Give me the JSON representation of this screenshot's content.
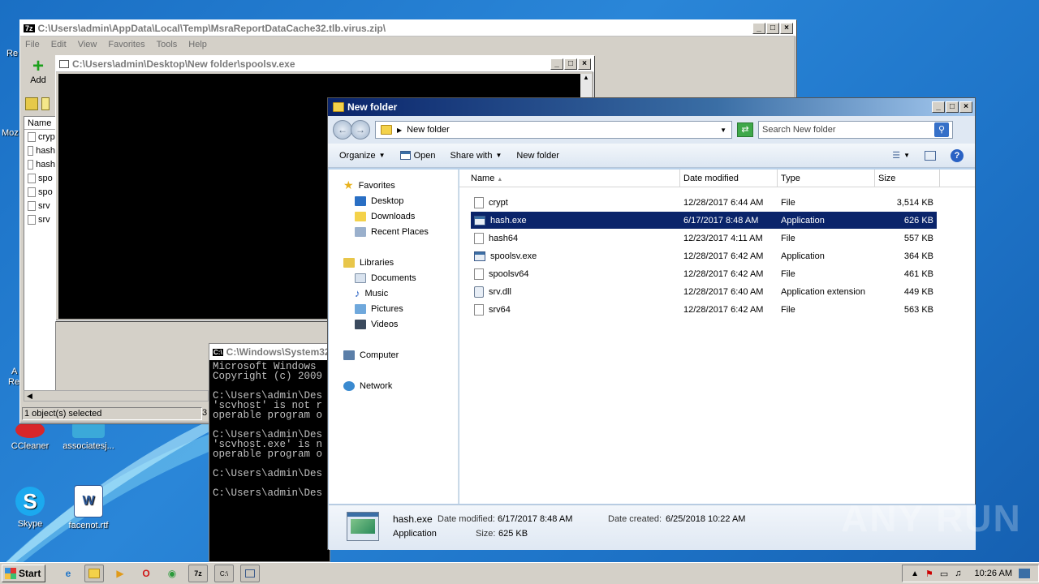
{
  "desktop": {
    "icons": [
      {
        "label": "CCleaner"
      },
      {
        "label": "associatesj..."
      },
      {
        "label": "Skype"
      },
      {
        "label": "facenot.rtf"
      }
    ],
    "left_edge_labels": [
      "Re",
      "Moz",
      "A",
      "Re"
    ],
    "watermark": "ANY RUN"
  },
  "zip_window": {
    "title": "C:\\Users\\admin\\AppData\\Local\\Temp\\MsraReportDataCache32.tlb.virus.zip\\",
    "menu": [
      "File",
      "Edit",
      "View",
      "Favorites",
      "Tools",
      "Help"
    ],
    "add_label": "Add",
    "col_name": "Name",
    "items": [
      "cryp",
      "hash",
      "hash",
      "spo",
      "spo",
      "srv",
      "srv"
    ],
    "status": "1 object(s) selected",
    "status2": "3"
  },
  "spoolsv_window": {
    "title": "C:\\Users\\admin\\Desktop\\New folder\\spoolsv.exe"
  },
  "cmd_window": {
    "title": "C:\\Windows\\System32",
    "lines": [
      "Microsoft Windows",
      "Copyright (c) 2009",
      "",
      "C:\\Users\\admin\\Des",
      "'scvhost' is not r",
      "operable program o",
      "",
      "C:\\Users\\admin\\Des",
      "'scvhost.exe' is n",
      "operable program o",
      "",
      "C:\\Users\\admin\\Des",
      "",
      "C:\\Users\\admin\\Des"
    ]
  },
  "explorer": {
    "title": "New folder",
    "address": "New folder",
    "search_placeholder": "Search New folder",
    "toolbar": {
      "organize": "Organize",
      "open": "Open",
      "share": "Share with",
      "new_folder": "New folder"
    },
    "nav": {
      "favorites": "Favorites",
      "fav_items": [
        "Desktop",
        "Downloads",
        "Recent Places"
      ],
      "libraries": "Libraries",
      "lib_items": [
        "Documents",
        "Music",
        "Pictures",
        "Videos"
      ],
      "computer": "Computer",
      "network": "Network"
    },
    "columns": [
      "Name",
      "Date modified",
      "Type",
      "Size"
    ],
    "files": [
      {
        "name": "crypt",
        "date": "12/28/2017 6:44 AM",
        "type": "File",
        "size": "3,514 KB",
        "icon": "file-icon"
      },
      {
        "name": "hash.exe",
        "date": "6/17/2017 8:48 AM",
        "type": "Application",
        "size": "626 KB",
        "icon": "app-icon"
      },
      {
        "name": "hash64",
        "date": "12/23/2017 4:11 AM",
        "type": "File",
        "size": "557 KB",
        "icon": "file-icon"
      },
      {
        "name": "spoolsv.exe",
        "date": "12/28/2017 6:42 AM",
        "type": "Application",
        "size": "364 KB",
        "icon": "app-icon"
      },
      {
        "name": "spoolsv64",
        "date": "12/28/2017 6:42 AM",
        "type": "File",
        "size": "461 KB",
        "icon": "file-icon"
      },
      {
        "name": "srv.dll",
        "date": "12/28/2017 6:40 AM",
        "type": "Application extension",
        "size": "449 KB",
        "icon": "dll-icon"
      },
      {
        "name": "srv64",
        "date": "12/28/2017 6:42 AM",
        "type": "File",
        "size": "563 KB",
        "icon": "file-icon"
      }
    ],
    "details": {
      "name": "hash.exe",
      "modified_label": "Date modified:",
      "modified": "6/17/2017 8:48 AM",
      "created_label": "Date created:",
      "created": "6/25/2018 10:22 AM",
      "type": "Application",
      "size_label": "Size:",
      "size": "625 KB"
    }
  },
  "taskbar": {
    "start": "Start",
    "clock": "10:26 AM"
  }
}
